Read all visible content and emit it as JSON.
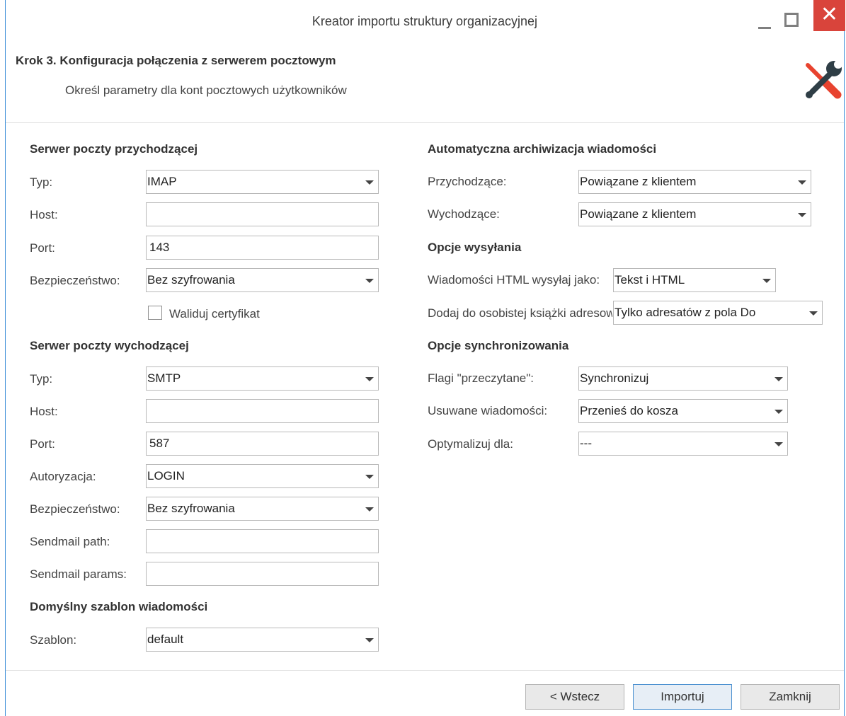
{
  "window": {
    "title": "Kreator importu struktury organizacyjnej",
    "close_glyph": "✕"
  },
  "header": {
    "step_title": "Krok 3. Konfiguracja połączenia z serwerem pocztowym",
    "step_subtitle": "Określ parametry dla kont pocztowych użytkowników",
    "icon": "tools-icon"
  },
  "incoming": {
    "title": "Serwer poczty przychodzącej",
    "type_label": "Typ:",
    "type_value": "IMAP",
    "host_label": "Host:",
    "host_value": "",
    "port_label": "Port:",
    "port_value": "143",
    "security_label": "Bezpieczeństwo:",
    "security_value": "Bez szyfrowania",
    "validate_label": "Waliduj certyfikat"
  },
  "outgoing": {
    "title": "Serwer poczty wychodzącej",
    "type_label": "Typ:",
    "type_value": "SMTP",
    "host_label": "Host:",
    "host_value": "",
    "port_label": "Port:",
    "port_value": "587",
    "auth_label": "Autoryzacja:",
    "auth_value": "LOGIN",
    "security_label": "Bezpieczeństwo:",
    "security_value": "Bez szyfrowania",
    "sendmail_path_label": "Sendmail path:",
    "sendmail_path_value": "",
    "sendmail_params_label": "Sendmail params:",
    "sendmail_params_value": ""
  },
  "template": {
    "title": "Domyślny szablon wiadomości",
    "label": "Szablon:",
    "value": "default"
  },
  "archive": {
    "title": "Automatyczna archiwizacja wiadomości",
    "incoming_label": "Przychodzące:",
    "incoming_value": "Powiązane z klientem",
    "outgoing_label": "Wychodzące:",
    "outgoing_value": "Powiązane z klientem"
  },
  "sending": {
    "title": "Opcje wysyłania",
    "html_label": "Wiadomości HTML wysyłaj jako:",
    "html_value": "Tekst i HTML",
    "addressbook_label": "Dodaj do osobistej książki adresowej:",
    "addressbook_value": "Tylko adresatów z pola Do"
  },
  "sync": {
    "title": "Opcje synchronizowania",
    "read_flags_label": "Flagi \"przeczytane\":",
    "read_flags_value": "Synchronizuj",
    "deleted_label": "Usuwane wiadomości:",
    "deleted_value": "Przenieś do kosza",
    "optimize_label": "Optymalizuj dla:",
    "optimize_value": "---"
  },
  "footer": {
    "back_label": "< Wstecz",
    "import_label": "Importuj",
    "close_label": "Zamknij"
  },
  "colors": {
    "accent": "#3c8ed8",
    "close_button": "#d9443b",
    "icon_red": "#e8432f",
    "icon_dark": "#2f3e46"
  }
}
